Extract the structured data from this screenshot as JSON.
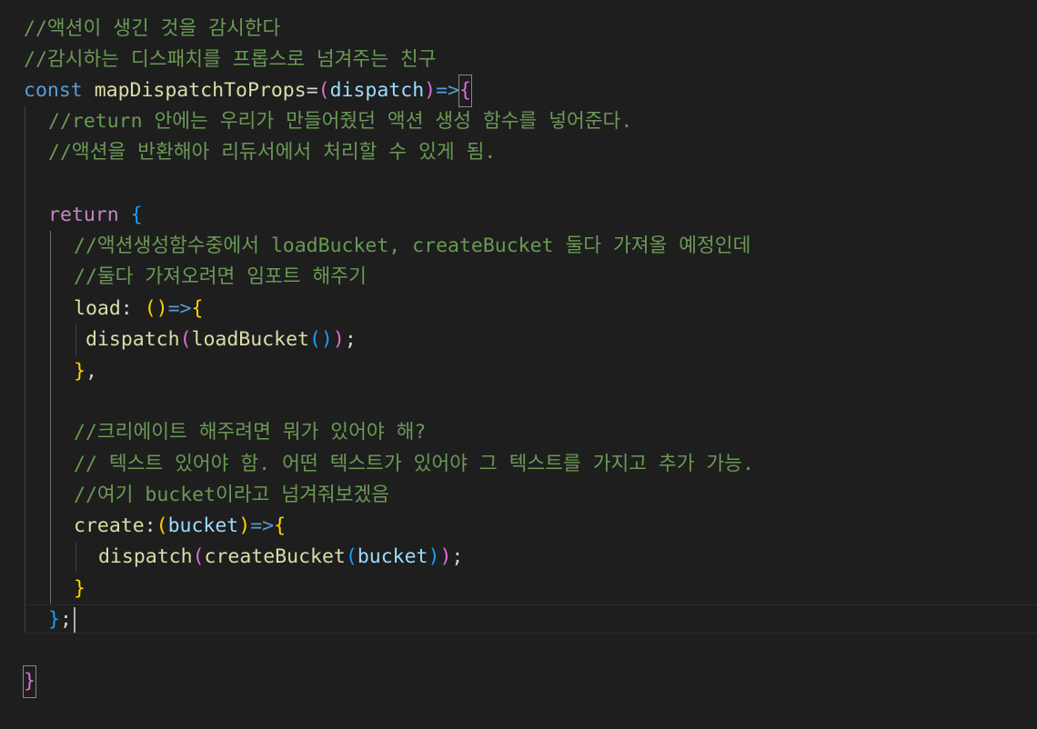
{
  "editor": {
    "lines": [
      {
        "comment": "//액션이 생긴 것을 감시한다"
      },
      {
        "comment": "//감시하는 디스패치를 프롭스로 넘겨주는 친구"
      },
      {
        "kw": "const",
        "fn": "mapDispatchToProps",
        "eq": "=",
        "open": "(",
        "param": "dispatch",
        "close": ")",
        "arrow": "=>",
        "brace": "{"
      },
      {
        "comment": "//return 안에는 우리가 만들어줬던 액션 생성 함수를 넣어준다."
      },
      {
        "comment": "//액션을 반환해아 리듀서에서 처리할 수 있게 됨."
      },
      {},
      {
        "kw": "return",
        "brace": "{"
      },
      {
        "comment": "//액션생성함수중에서 loadBucket, createBucket 둘다 가져올 예정인데"
      },
      {
        "comment": "//둘다 가져오려면 임포트 해주기"
      },
      {
        "prop": "load",
        "colon": ":",
        "parens": "()",
        "arrow": "=>",
        "brace": "{"
      },
      {
        "fn": "dispatch",
        "open": "(",
        "inner_fn": "loadBucket",
        "inner_parens": "()",
        "close": ")",
        "semi": ";"
      },
      {
        "brace": "}",
        "comma": ","
      },
      {},
      {
        "comment": "//크리에이트 해주려면 뭐가 있어야 해?"
      },
      {
        "comment": "// 텍스트 있어야 함. 어떤 텍스트가 있어야 그 텍스트를 가지고 추가 가능."
      },
      {
        "comment": "//여기 bucket이라고 넘겨줘보겠음"
      },
      {
        "prop": "create",
        "colon": ":",
        "open": "(",
        "param": "bucket",
        "close": ")",
        "arrow": "=>",
        "brace": "{"
      },
      {
        "fn": "dispatch",
        "open": "(",
        "inner_fn": "createBucket",
        "inner_open": "(",
        "param": "bucket",
        "inner_close": ")",
        "close": ")",
        "semi": ";"
      },
      {
        "brace": "}"
      },
      {
        "brace": "}",
        "semi": ";"
      },
      {},
      {
        "brace": "}"
      }
    ]
  },
  "colors": {
    "background": "#1e1e1e",
    "comment": "#6a9955",
    "keyword": "#569cd6",
    "control": "#c586c0",
    "function": "#dcdcaa",
    "variable": "#9cdcfe",
    "bracket_gold": "#ffd700",
    "bracket_orchid": "#da70d6",
    "bracket_blue": "#179fff"
  }
}
